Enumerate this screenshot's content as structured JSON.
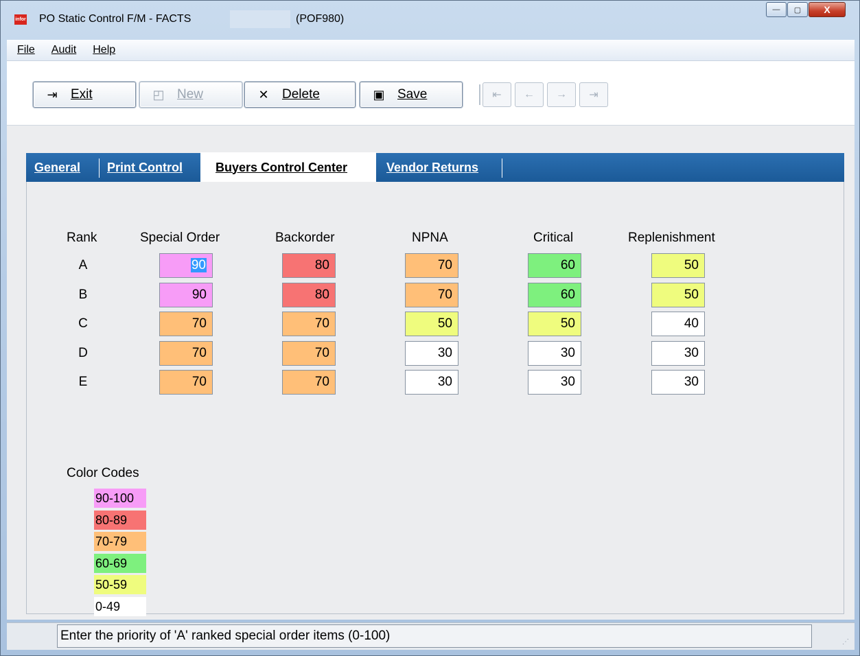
{
  "window": {
    "title": "PO Static Control F/M - FACTS",
    "code": "(POF980)",
    "app_icon_text": "infor",
    "minimize": "—",
    "maximize": "▢",
    "close": "X"
  },
  "menu": [
    {
      "label": "File"
    },
    {
      "label": "Audit"
    },
    {
      "label": "Help"
    }
  ],
  "toolbar": {
    "exit": "Exit",
    "new": "New",
    "delete": "Delete",
    "save": "Save"
  },
  "tabs": [
    {
      "label": "General"
    },
    {
      "label": "Print Control"
    },
    {
      "label": "Buyers Control Center"
    },
    {
      "label": "Vendor Returns"
    }
  ],
  "active_tab": "Buyers Control Center",
  "grid": {
    "rank_header": "Rank",
    "columns": [
      "Special Order",
      "Backorder",
      "NPNA",
      "Critical",
      "Replenishment"
    ],
    "rows": [
      {
        "rank": "A",
        "values": [
          "90",
          "80",
          "70",
          "60",
          "50"
        ]
      },
      {
        "rank": "B",
        "values": [
          "90",
          "80",
          "70",
          "60",
          "50"
        ]
      },
      {
        "rank": "C",
        "values": [
          "70",
          "70",
          "50",
          "50",
          "40"
        ]
      },
      {
        "rank": "D",
        "values": [
          "70",
          "70",
          "30",
          "30",
          "30"
        ]
      },
      {
        "rank": "E",
        "values": [
          "70",
          "70",
          "30",
          "30",
          "30"
        ]
      }
    ]
  },
  "color_codes": {
    "title": "Color Codes",
    "items": [
      {
        "label": "90-100",
        "color": "#f79cf7"
      },
      {
        "label": "80-89",
        "color": "#f77373"
      },
      {
        "label": "70-79",
        "color": "#ffbf78"
      },
      {
        "label": "60-69",
        "color": "#7ef07e"
      },
      {
        "label": "50-59",
        "color": "#effc7e"
      },
      {
        "label": "0-49",
        "color": "#ffffff"
      }
    ]
  },
  "status": {
    "message": "Enter the priority of 'A' ranked special order items (0-100)"
  }
}
